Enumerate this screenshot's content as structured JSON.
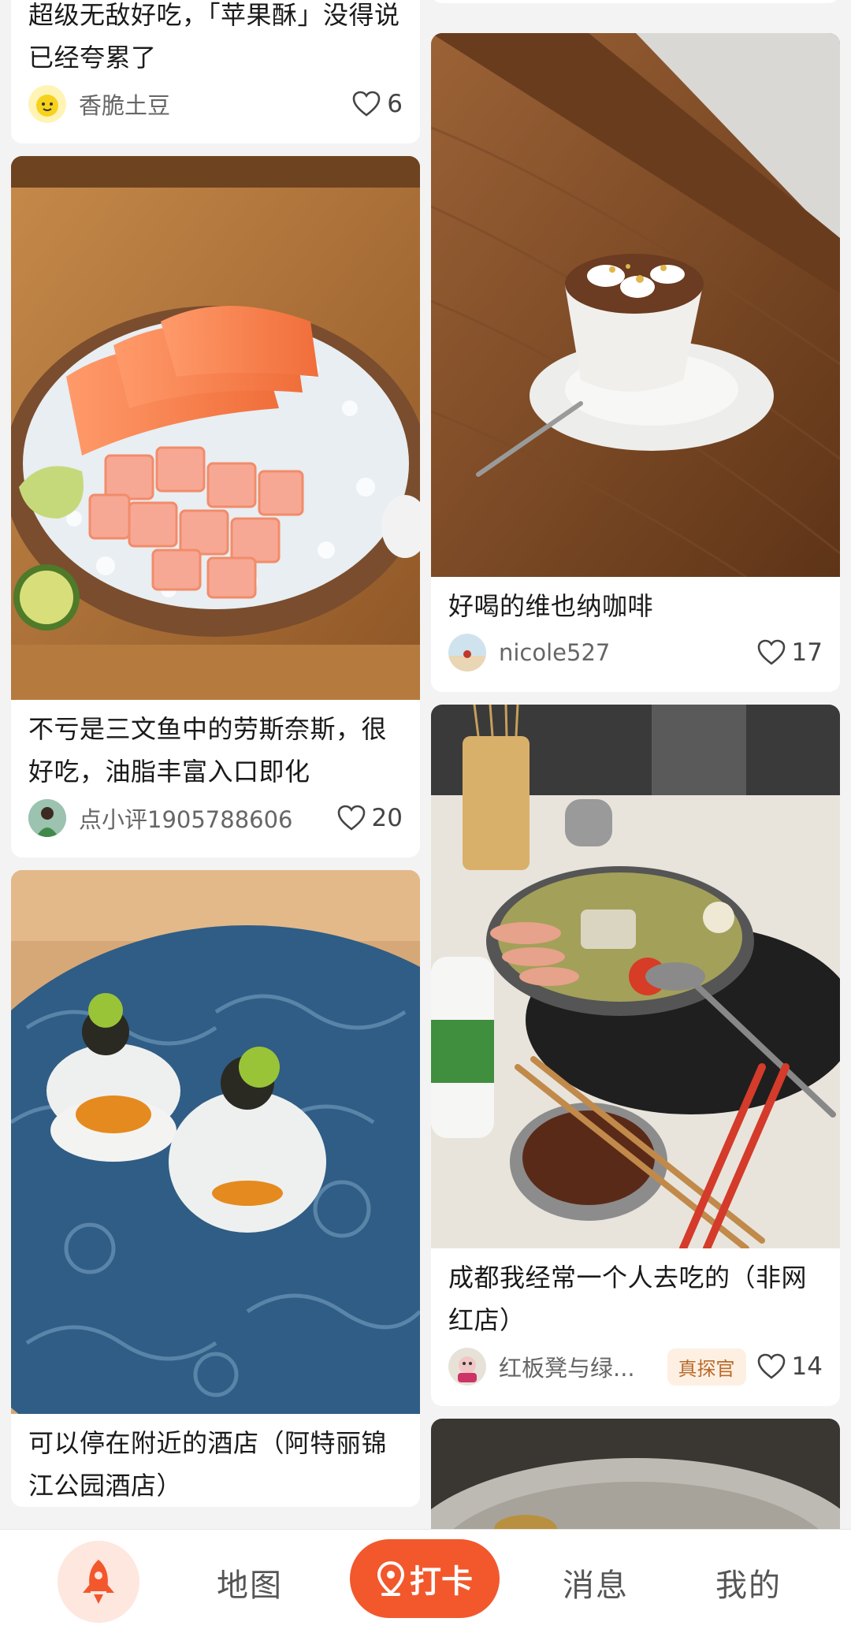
{
  "feed": {
    "left": [
      {
        "title": "超级无敌好吃，「苹果酥」没得说已经夸累了",
        "author": "香脆土豆",
        "likes": "6"
      },
      {
        "title": "不亏是三文鱼中的劳斯奈斯，很好吃，油脂丰富入口即化",
        "author": "点小评1905788606",
        "likes": "20"
      },
      {
        "title": "可以停在附近的酒店（阿特丽锦江公园酒店）"
      }
    ],
    "right": [
      {
        "title": "好喝的维也纳咖啡",
        "author": "nicole527",
        "likes": "17"
      },
      {
        "title": "成都我经常一个人去吃的（非网红店）",
        "author": "红板凳与绿...",
        "badge": "真探官",
        "likes": "14"
      }
    ]
  },
  "nav": {
    "map": "地图",
    "checkin": "打卡",
    "messages": "消息",
    "mine": "我的"
  },
  "icons": {
    "like": "heart-icon",
    "home": "rocket-icon",
    "checkin": "location-pin-icon"
  },
  "colors": {
    "accent": "#f2582c",
    "badge_bg": "#fdf0e3",
    "badge_text": "#b86a2a"
  }
}
